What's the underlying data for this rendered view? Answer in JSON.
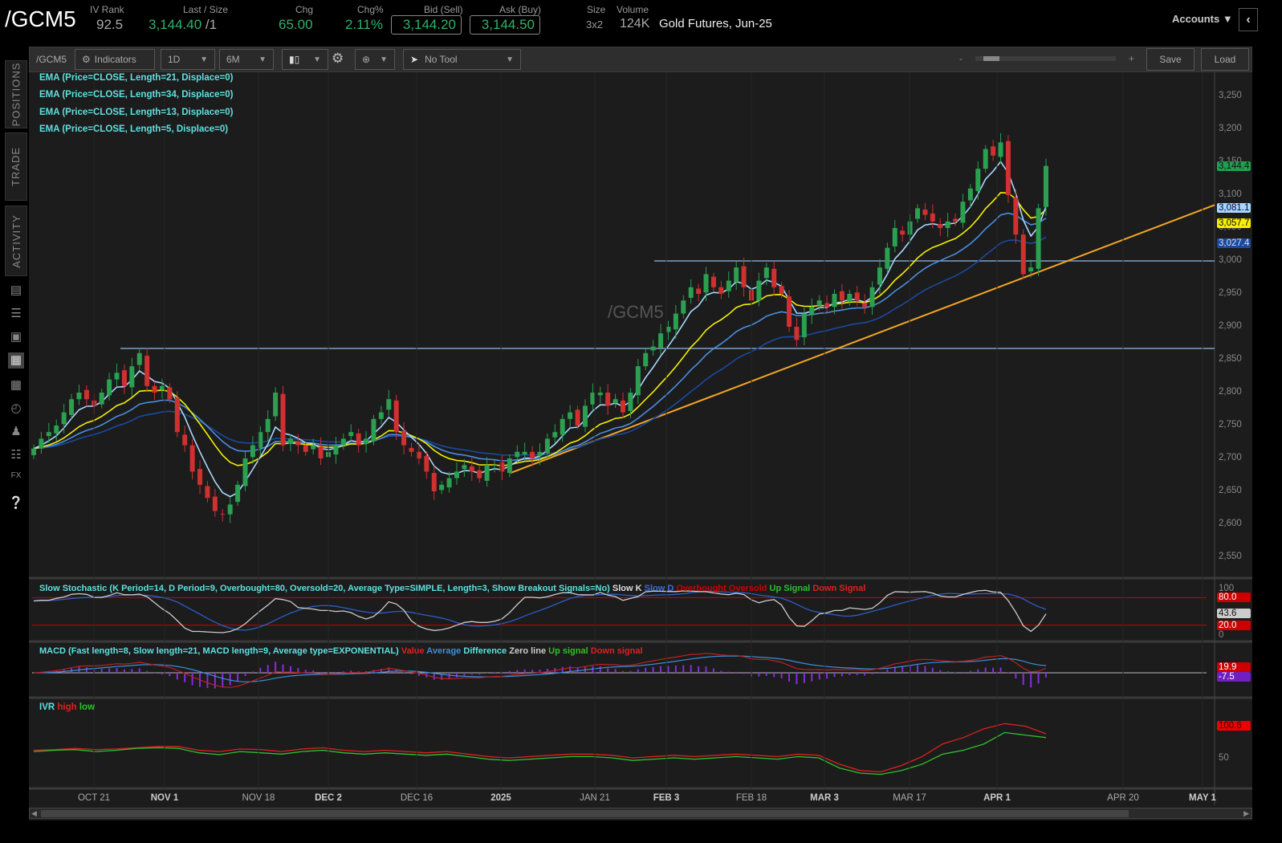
{
  "header": {
    "symbol": "/GCM5",
    "iv_rank_label": "IV Rank",
    "iv_rank": "92.5",
    "last_label": "Last / Size",
    "last": "3,144.40",
    "size": "/1",
    "chg_label": "Chg",
    "chg": "65.00",
    "chgpct_label": "Chg%",
    "chgpct": "2.11%",
    "bid_label": "Bid (Sell)",
    "bid": "3,144.20",
    "ask_label": "Ask (Buy)",
    "ask": "3,144.50",
    "size_label": "Size",
    "size_val": "3x2",
    "volume_label": "Volume",
    "volume": "124K",
    "description": "Gold Futures, Jun-25",
    "accounts": "Accounts"
  },
  "sidebar": {
    "tabs": [
      "POSITIONS",
      "TRADE",
      "ACTIVITY"
    ]
  },
  "toolbar": {
    "symbol": "/GCM5",
    "indicators": "Indicators",
    "aggregation": "1D",
    "timeframe": "6M",
    "tool": "No Tool",
    "zoom_minus": "-",
    "zoom_plus": "+",
    "save": "Save",
    "load": "Load"
  },
  "studies": [
    "EMA (Price=CLOSE, Length=21, Displace=0)",
    "EMA (Price=CLOSE, Length=34, Displace=0)",
    "EMA (Price=CLOSE, Length=13, Displace=0)",
    "EMA (Price=CLOSE, Length=5, Displace=0)"
  ],
  "watermark": "/GCM5",
  "price_axis": {
    "ticks": [
      "3,250",
      "3,200",
      "3,150",
      "3,100",
      "3,050",
      "3,000",
      "2,950",
      "2,900",
      "2,850",
      "2,800",
      "2,750",
      "2,700",
      "2,650",
      "2,600",
      "2,550"
    ],
    "tags": {
      "last": "3,144.4",
      "ema5": "3,081.1",
      "ema13": "3,057.7",
      "ema34": "3,027.4"
    },
    "colors": {
      "last": "#1fa050",
      "ema5": "#a8d8ff",
      "ema13": "#f5f000",
      "ema21": "#4a8fe0",
      "ema34": "#1a4aa0"
    }
  },
  "stochastic": {
    "title": "Slow Stochastic (K Period=14, D Period=9, Overbought=80, Oversold=20, Average Type=SIMPLE, Length=3, Show Breakout Signals=No)",
    "legend": [
      "Slow K",
      "Slow D",
      "Overbought",
      "Oversold",
      "Up Signal",
      "Down Signal"
    ],
    "axis": [
      "100",
      "80.0",
      "43.6",
      "20.0",
      "0"
    ]
  },
  "macd": {
    "title": "MACD (Fast length=8, Slow length=21, MACD length=9, Average type=EXPONENTIAL)",
    "legend": [
      "Value",
      "Average",
      "Difference",
      "Zero line",
      "Up signal",
      "Down signal"
    ],
    "axis": [
      "19.9",
      "-7.5"
    ]
  },
  "ivr": {
    "title": "IVR",
    "legend": [
      "high",
      "low"
    ],
    "axis": [
      "100.6",
      "50"
    ],
    "high": [
      62,
      63,
      65,
      63,
      64,
      66,
      68,
      68,
      62,
      60,
      64,
      63,
      60,
      64,
      66,
      62,
      60,
      62,
      60,
      58,
      60,
      56,
      52,
      50,
      52,
      54,
      56,
      56,
      54,
      50,
      52,
      54,
      52,
      54,
      56,
      54,
      52,
      56,
      54,
      40,
      30,
      28,
      38,
      52,
      72,
      82,
      96,
      104,
      100,
      88
    ],
    "low": [
      60,
      62,
      63,
      60,
      62,
      65,
      66,
      65,
      58,
      55,
      60,
      58,
      56,
      60,
      62,
      58,
      56,
      58,
      56,
      54,
      56,
      52,
      48,
      46,
      48,
      50,
      52,
      52,
      50,
      46,
      48,
      50,
      48,
      50,
      52,
      50,
      48,
      52,
      50,
      34,
      26,
      24,
      30,
      40,
      56,
      62,
      72,
      90,
      86,
      82
    ]
  },
  "chart_data": {
    "type": "candlestick",
    "symbol": "/GCM5",
    "ylim": [
      2520,
      3290
    ],
    "closes": [
      2715,
      2730,
      2740,
      2750,
      2770,
      2790,
      2800,
      2790,
      2780,
      2800,
      2820,
      2830,
      2810,
      2840,
      2860,
      2810,
      2800,
      2810,
      2790,
      2740,
      2720,
      2680,
      2660,
      2640,
      2620,
      2615,
      2630,
      2660,
      2700,
      2720,
      2740,
      2760,
      2800,
      2720,
      2730,
      2720,
      2710,
      2720,
      2700,
      2710,
      2720,
      2730,
      2740,
      2720,
      2730,
      2760,
      2770,
      2790,
      2740,
      2720,
      2710,
      2700,
      2680,
      2650,
      2660,
      2670,
      2680,
      2690,
      2680,
      2670,
      2690,
      2690,
      2680,
      2700,
      2710,
      2710,
      2700,
      2710,
      2730,
      2740,
      2760,
      2770,
      2750,
      2780,
      2800,
      2800,
      2780,
      2790,
      2770,
      2800,
      2840,
      2860,
      2870,
      2890,
      2900,
      2920,
      2940,
      2960,
      2950,
      2980,
      2960,
      2950,
      2970,
      2990,
      2960,
      2940,
      2970,
      2990,
      2960,
      2950,
      2900,
      2880,
      2920,
      2930,
      2940,
      2930,
      2950,
      2940,
      2950,
      2940,
      2930,
      2960,
      2990,
      3020,
      3050,
      3040,
      3060,
      3080,
      3070,
      3060,
      3050,
      3060,
      3060,
      3090,
      3110,
      3140,
      3170,
      3160,
      3180,
      3100,
      3040,
      2980,
      2990,
      3080,
      3144.4
    ],
    "levels": [
      3000,
      2867
    ],
    "trendline": {
      "from": 2678,
      "to": 3085
    },
    "x_ticks": [
      "OCT 21",
      "NOV 1",
      "NOV 18",
      "DEC 2",
      "DEC 16",
      "2025",
      "JAN 21",
      "FEB 3",
      "FEB 18",
      "MAR 3",
      "MAR 17",
      "APR 1",
      "APR 20",
      "MAY 1"
    ]
  }
}
